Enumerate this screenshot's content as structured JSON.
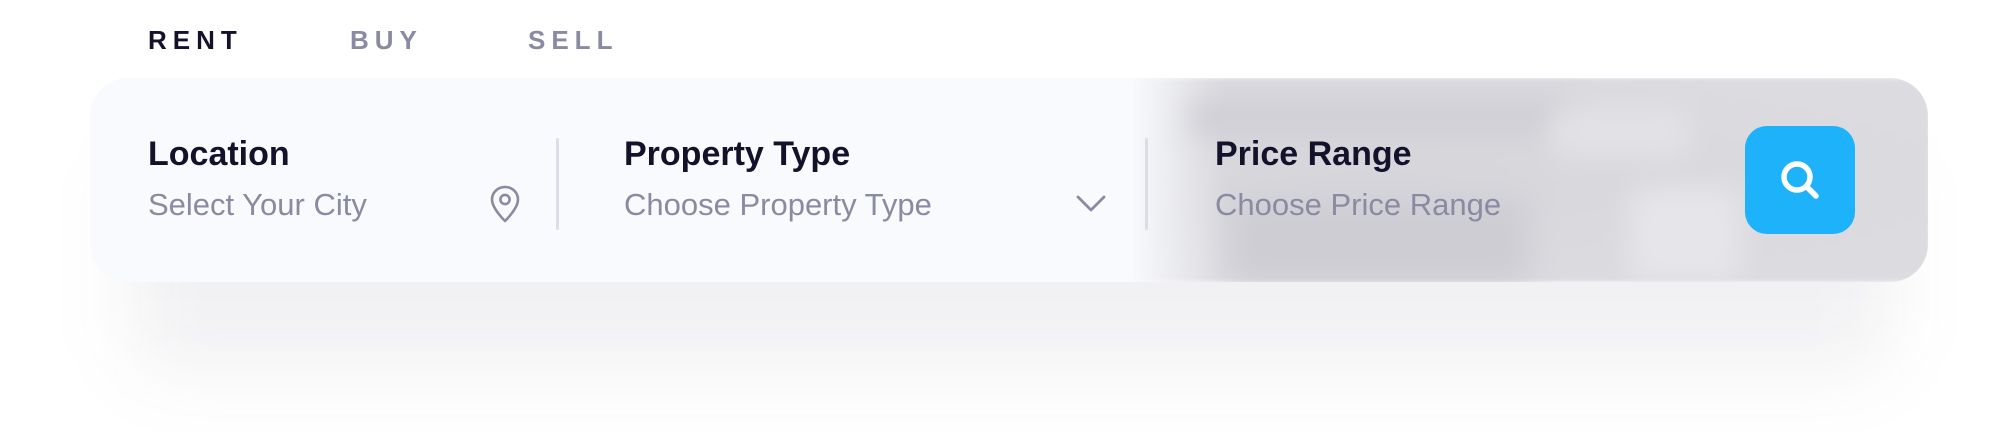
{
  "tabs": [
    {
      "label": "RENT",
      "active": true
    },
    {
      "label": "BUY",
      "active": false
    },
    {
      "label": "SELL",
      "active": false
    }
  ],
  "search": {
    "location": {
      "label": "Location",
      "placeholder": "Select Your City",
      "icon": "map-pin-icon"
    },
    "property_type": {
      "label": "Property Type",
      "placeholder": "Choose Property Type",
      "icon": "chevron-down-icon"
    },
    "price_range": {
      "label": "Price Range",
      "placeholder": "Choose Price Range"
    },
    "button": {
      "icon": "search-icon"
    }
  },
  "colors": {
    "accent": "#1eb2fb",
    "text_primary": "#14112b",
    "text_muted": "#8a8aa3",
    "card_bg": "#f9fafd"
  }
}
